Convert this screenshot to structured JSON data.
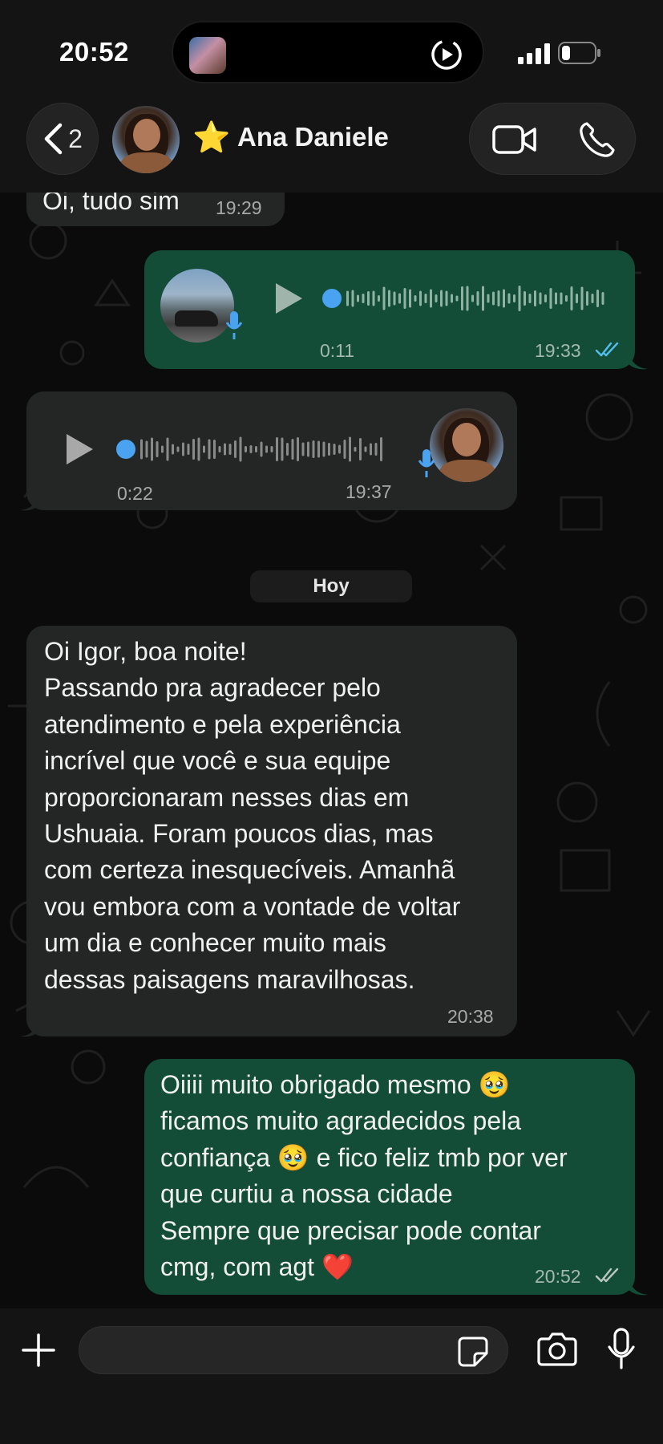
{
  "status_bar": {
    "time": "20:52"
  },
  "header": {
    "back_count": "2",
    "contact_emoji": "⭐",
    "contact_name": "Ana Daniele"
  },
  "messages": [
    {
      "direction": "in",
      "kind": "text",
      "text": "Oi, tudo sim",
      "time": "19:29"
    },
    {
      "direction": "out",
      "kind": "voice",
      "duration": "0:11",
      "time": "19:33",
      "status": "read"
    },
    {
      "direction": "in",
      "kind": "voice",
      "duration": "0:22",
      "time": "19:37"
    },
    {
      "direction": "in",
      "kind": "text",
      "text": "Oi Igor, boa noite!\nPassando pra agradecer pelo\natendimento e pela experiência\nincrível que você e sua equipe\nproporcionaram nesses dias em\nUshuaia. Foram poucos dias, mas\ncom certeza inesquecíveis. Amanhã\nvou embora com a vontade de voltar\num dia e conhecer muito mais\ndessas paisagens maravilhosas.",
      "time": "20:38"
    },
    {
      "direction": "out",
      "kind": "text",
      "text": "Oiiii muito obrigado mesmo 🥹\nficamos muito agradecidos pela\nconfiança 🥹 e fico feliz tmb por ver\nque curtiu a nossa cidade\nSempre que precisar pode contar\ncmg, com agt ❤️",
      "time": "20:52",
      "status": "delivered"
    }
  ],
  "date_separator": "Hoy",
  "composer": {
    "value": "",
    "placeholder": ""
  },
  "colors": {
    "incoming_bubble": "#242626",
    "outgoing_bubble": "#144d37",
    "accent_blue": "#4aa3f0",
    "read_tick": "#53bdeb"
  }
}
